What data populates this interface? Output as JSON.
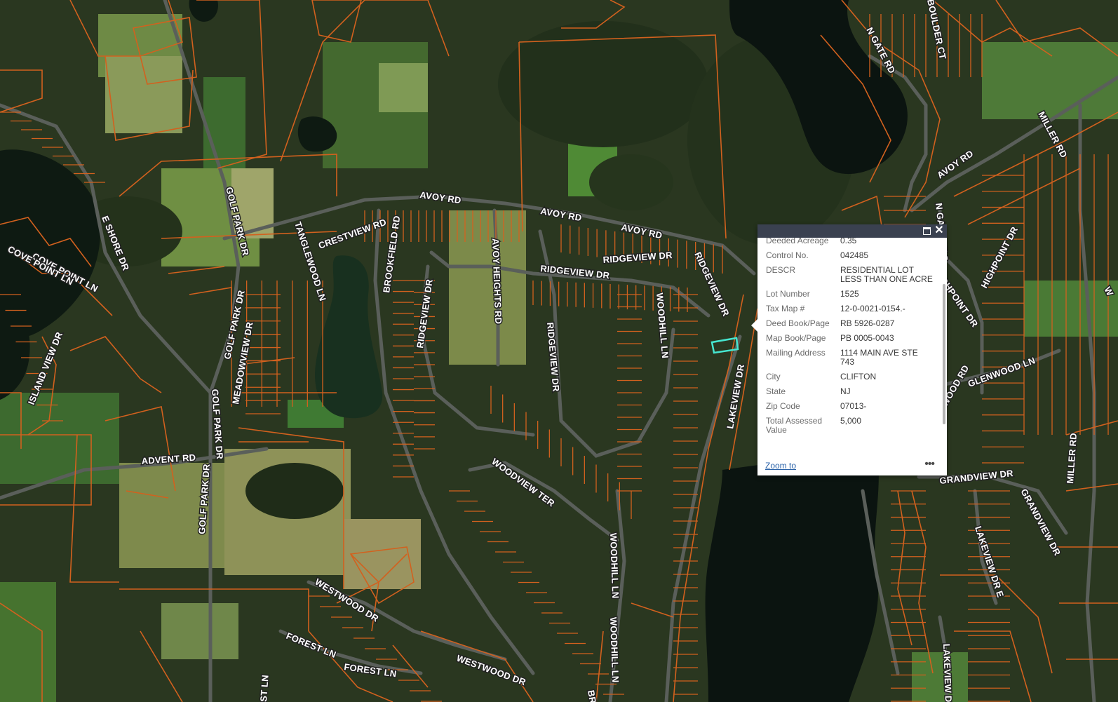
{
  "map": {
    "road_labels": [
      "AVOY RD",
      "AVOY RD",
      "AVOY RD",
      "AVOY RD",
      "CRESTVIEW RD",
      "TANGLEWOOD LN",
      "BROOKFIELD RD",
      "AVOY HEIGHTS RD",
      "RIDGEVIEW DR",
      "RIDGEVIEW DR",
      "RIDGEVIEW DR",
      "RIDGEVIEW DR",
      "RIDGEVIEW DR",
      "WOODHILL LN",
      "WOODHILL LN",
      "WOODHILL LN",
      "GOLF PARK DR",
      "GOLF PARK DR",
      "GOLF PARK DR",
      "GOLF PARK DR",
      "MEADOWVIEW DR",
      "E SHORE DR",
      "COVE POINT LN",
      "COVE POINT LN",
      "ISLAND VIEW DR",
      "ADVENT RD",
      "WOODVIEW TER",
      "WESTWOOD DR",
      "WESTWOOD DR",
      "FOREST LN",
      "FOREST LN",
      "LAKEVIEW DR",
      "LAKEVIEW DR",
      "LAKEVIEW DR E",
      "N GATE RD",
      "N GATE CT S",
      "BOULDER CT",
      "HIGHPOINT DR",
      "HIGHPOINT DR",
      "MILLER RD",
      "MILLER RD",
      "GLENWOOD LN",
      "GRANDVIEW DR",
      "GRANDVIEW DR",
      "ELMWOOD RD",
      "W",
      "ST LN",
      "BR"
    ]
  },
  "popup": {
    "fields": [
      {
        "name": "Deeded Acreage",
        "value": "0.35"
      },
      {
        "name": "Control No.",
        "value": "042485"
      },
      {
        "name": "DESCR",
        "value": "RESIDENTIAL LOT LESS THAN ONE ACRE"
      },
      {
        "name": "Lot Number",
        "value": "1525"
      },
      {
        "name": "Tax Map #",
        "value": "12-0-0021-0154.-"
      },
      {
        "name": "Deed Book/Page",
        "value": "RB 5926-0287"
      },
      {
        "name": "Map Book/Page",
        "value": "PB 0005-0043"
      },
      {
        "name": "Mailing Address",
        "value": "1114 MAIN AVE STE 743"
      },
      {
        "name": "City",
        "value": "CLIFTON"
      },
      {
        "name": "State",
        "value": "NJ"
      },
      {
        "name": "Zip Code",
        "value": "07013-"
      },
      {
        "name": "Total Assessed Value",
        "value": "5,000"
      }
    ],
    "zoom_label": "Zoom to",
    "more_label": "•••",
    "maximize_icon": "maximize-icon",
    "close_icon": "close-icon",
    "close_glyph": "✕"
  },
  "colors": {
    "parcel_line": "#d2611e",
    "selected_parcel": "#46e6d0",
    "popup_header": "#3a4150",
    "link": "#2a62a8"
  }
}
